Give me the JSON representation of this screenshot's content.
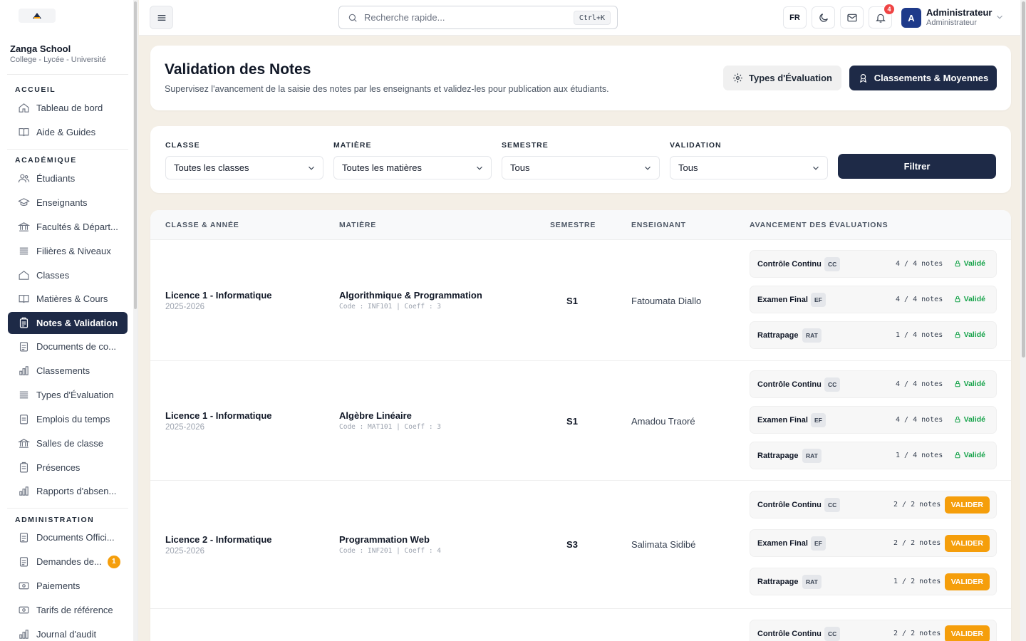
{
  "sidebar": {
    "school_name": "Zanga School",
    "school_sub": "College - Lycée - Université",
    "sections": {
      "accueil": "ACCUEIL",
      "academique": "ACADÉMIQUE",
      "administration": "ADMINISTRATION"
    },
    "items": {
      "tableau": "Tableau de bord",
      "aide": "Aide & Guides",
      "etudiants": "Étudiants",
      "enseignants": "Enseignants",
      "facultes": "Facultés & Départ...",
      "filieres": "Filières & Niveaux",
      "classes": "Classes",
      "matieres": "Matières & Cours",
      "notes": "Notes & Validation",
      "documents": "Documents de co...",
      "classements": "Classements",
      "types": "Types d'Évaluation",
      "emplois": "Emplois du temps",
      "salles": "Salles de classe",
      "presences": "Présences",
      "rapports": "Rapports d'absen...",
      "docs_officiels": "Documents Offici...",
      "demandes": "Demandes de...",
      "demandes_badge": "1",
      "paiements": "Paiements",
      "tarifs": "Tarifs de référence",
      "journal": "Journal d'audit"
    }
  },
  "topbar": {
    "search_placeholder": "Recherche rapide...",
    "search_shortcut": "Ctrl+K",
    "lang": "FR",
    "notif_count": "4",
    "user_initial": "A",
    "user_name": "Administrateur",
    "user_role": "Administrateur"
  },
  "header": {
    "title": "Validation des Notes",
    "description": "Supervisez l'avancement de la saisie des notes par les enseignants et validez-les pour publication aux étudiants.",
    "btn_types": "Types d'Évaluation",
    "btn_classements": "Classements & Moyennes"
  },
  "filters": {
    "classe_label": "CLASSE",
    "classe_value": "Toutes les classes",
    "matiere_label": "MATIÈRE",
    "matiere_value": "Toutes les matières",
    "semestre_label": "SEMESTRE",
    "semestre_value": "Tous",
    "validation_label": "VALIDATION",
    "validation_value": "Tous",
    "btn_filter": "Filtrer"
  },
  "table": {
    "headers": {
      "classe": "CLASSE & ANNÉE",
      "matiere": "MATIÈRE",
      "semestre": "SEMESTRE",
      "enseignant": "ENSEIGNANT",
      "avancement": "AVANCEMENT DES ÉVALUATIONS"
    },
    "rows": [
      {
        "classe": "Licence 1 - Informatique",
        "annee": "2025-2026",
        "matiere": "Algorithmique & Programmation",
        "code": "Code : INF101 | Coeff : 3",
        "semestre": "S1",
        "enseignant": "Fatoumata Diallo",
        "evals": [
          {
            "name": "Contrôle Continu",
            "code": "CC",
            "notes": "4 / 4 notes",
            "status": "Validé"
          },
          {
            "name": "Examen Final",
            "code": "EF",
            "notes": "4 / 4 notes",
            "status": "Validé"
          },
          {
            "name": "Rattrapage",
            "code": "RAT",
            "notes": "1 / 4 notes",
            "status": "Validé"
          }
        ]
      },
      {
        "classe": "Licence 1 - Informatique",
        "annee": "2025-2026",
        "matiere": "Algèbre Linéaire",
        "code": "Code : MAT101 | Coeff : 3",
        "semestre": "S1",
        "enseignant": "Amadou Traoré",
        "evals": [
          {
            "name": "Contrôle Continu",
            "code": "CC",
            "notes": "4 / 4 notes",
            "status": "Validé"
          },
          {
            "name": "Examen Final",
            "code": "EF",
            "notes": "4 / 4 notes",
            "status": "Validé"
          },
          {
            "name": "Rattrapage",
            "code": "RAT",
            "notes": "1 / 4 notes",
            "status": "Validé"
          }
        ]
      },
      {
        "classe": "Licence 2 - Informatique",
        "annee": "2025-2026",
        "matiere": "Programmation Web",
        "code": "Code : INF201 | Coeff : 4",
        "semestre": "S3",
        "enseignant": "Salimata Sidibé",
        "evals": [
          {
            "name": "Contrôle Continu",
            "code": "CC",
            "notes": "2 / 2 notes",
            "action": "VALIDER"
          },
          {
            "name": "Examen Final",
            "code": "EF",
            "notes": "2 / 2 notes",
            "action": "VALIDER"
          },
          {
            "name": "Rattrapage",
            "code": "RAT",
            "notes": "1 / 2 notes",
            "action": "VALIDER"
          }
        ]
      },
      {
        "evals": [
          {
            "name": "Contrôle Continu",
            "code": "CC",
            "notes": "2 / 2 notes",
            "action": "VALIDER"
          }
        ]
      }
    ]
  },
  "colors": {
    "primary": "#1e2a47",
    "accent": "#f59e0b",
    "success": "#16a34a",
    "danger": "#ef4444",
    "page_bg": "#f4efe6"
  }
}
